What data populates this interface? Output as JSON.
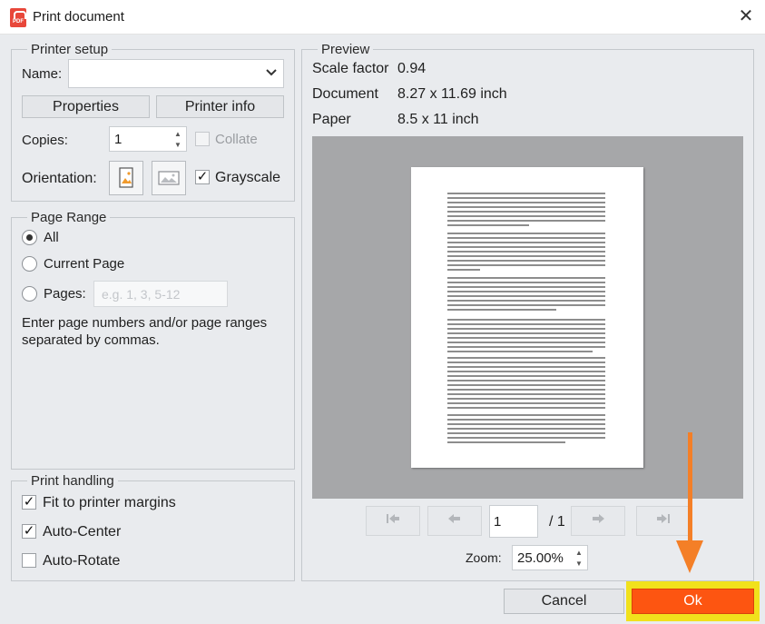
{
  "window": {
    "title": "Print document",
    "app_icon_text": "PDF"
  },
  "printer_setup": {
    "legend": "Printer setup",
    "name_label": "Name:",
    "name_value": "",
    "properties_label": "Properties",
    "printer_info_label": "Printer info",
    "copies_label": "Copies:",
    "copies_value": "1",
    "collate_label": "Collate",
    "collate_checked": false,
    "orientation_label": "Orientation:",
    "grayscale_label": "Grayscale",
    "grayscale_checked": true
  },
  "page_range": {
    "legend": "Page Range",
    "options": [
      {
        "label": "All",
        "selected": true
      },
      {
        "label": "Current Page",
        "selected": false
      },
      {
        "label": "Pages:",
        "selected": false
      }
    ],
    "pages_placeholder": "e.g. 1, 3, 5-12",
    "hint": "Enter page numbers and/or page ranges separated by commas."
  },
  "print_handling": {
    "legend": "Print handling",
    "options": [
      {
        "label": "Fit to printer margins",
        "checked": true
      },
      {
        "label": "Auto-Center",
        "checked": true
      },
      {
        "label": "Auto-Rotate",
        "checked": false
      }
    ]
  },
  "preview": {
    "legend": "Preview",
    "scale_label": "Scale factor",
    "scale_value": "0.94",
    "document_label": "Document",
    "document_value": "8.27 x 11.69 inch",
    "paper_label": "Paper",
    "paper_value": "8.5 x 11 inch",
    "current_page": "1",
    "total_pages": "/ 1",
    "zoom_label": "Zoom:",
    "zoom_value": "25.00%"
  },
  "footer": {
    "cancel_label": "Cancel",
    "ok_label": "Ok"
  },
  "colors": {
    "ok_button": "#fd5511",
    "ok_highlight": "#f1e11c",
    "annotation_arrow": "#f47f27",
    "dialog_background": "#e9ebee"
  }
}
